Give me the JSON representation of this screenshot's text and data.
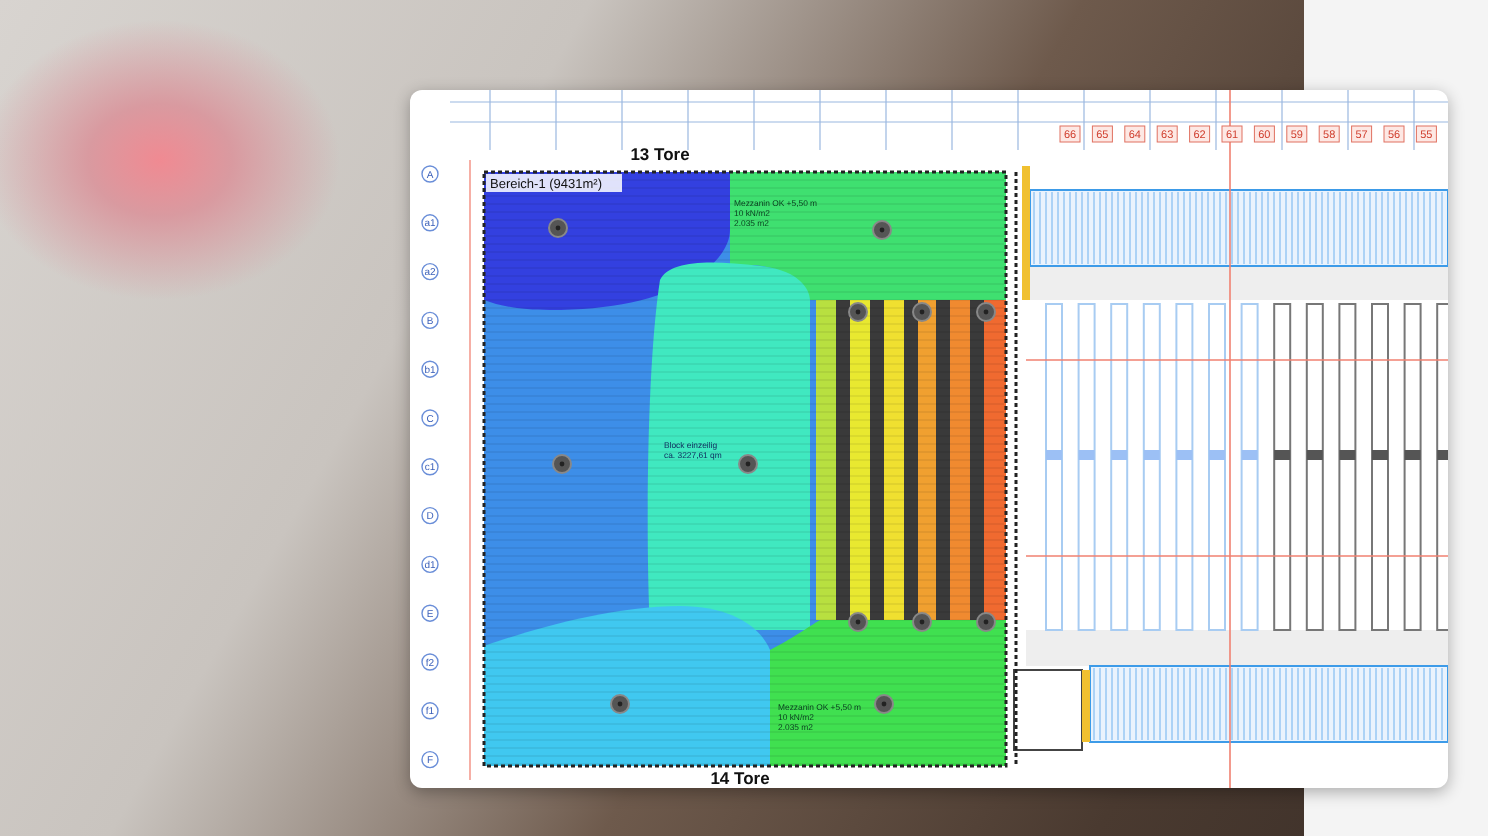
{
  "plan": {
    "top_label": "13 Tore",
    "bottom_label": "14 Tore",
    "area_label": "Bereich-1 (9431m²)",
    "axis_labels": [
      "A",
      "a1",
      "a2",
      "B",
      "b1",
      "C",
      "c1",
      "D",
      "d1",
      "E",
      "f2",
      "f1",
      "F"
    ],
    "bay_numbers": [
      "66",
      "65",
      "64",
      "63",
      "62",
      "61",
      "60",
      "59",
      "58",
      "57",
      "56",
      "55"
    ],
    "annotations": [
      {
        "kind": "mezzanine",
        "lines": [
          "Mezzanin OK +5,50 m",
          "10 kN/m2",
          "2.035 m2"
        ]
      },
      {
        "kind": "block",
        "lines": [
          "Block einzeilig",
          "ca. 3227,61 qm"
        ]
      },
      {
        "kind": "mezzanine",
        "lines": [
          "Mezzanin OK +5,50 m",
          "10 kN/m2",
          "2.035 m2"
        ]
      }
    ]
  }
}
